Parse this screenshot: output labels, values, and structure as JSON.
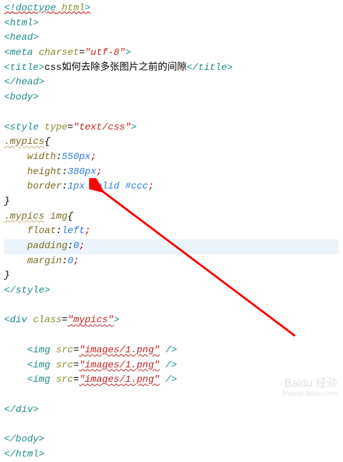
{
  "lines": {
    "l1_a": "<!",
    "l1_b": "doctype",
    "l1_c": " html",
    "l1_d": ">",
    "l2": "<html>",
    "l3": "<head>",
    "l4_a": "<meta ",
    "l4_attr": "charset",
    "l4_eq": "=",
    "l4_val": "\"utf-8\"",
    "l4_end": ">",
    "l5_a": "<title>",
    "l5_txt": "css如何去除多张图片之前的间隙",
    "l5_b": "</title>",
    "l6": "</head>",
    "l7": "<body>",
    "l9_a": "<style ",
    "l9_attr": "type",
    "l9_eq": "=",
    "l9_val": "\"text/css\"",
    "l9_end": ">",
    "l10_sel": ".mypics",
    "l10_brace": "{",
    "l11_prop": "width",
    "l11_val": "550px",
    "l12_prop": "height",
    "l12_val": "380px",
    "l13_prop": "border",
    "l13_val": "1px solid #ccc",
    "l14_brace": "}",
    "l15_sel1": ".mypics",
    "l15_sel2": " img",
    "l15_brace": "{",
    "l16_prop": "float",
    "l16_val": "left",
    "l17_prop": "padding",
    "l17_val": "0",
    "l18_prop": "margin",
    "l18_val": "0",
    "l19_brace": "}",
    "l20": "</style>",
    "l22_a": "<div ",
    "l22_attr": "class",
    "l22_eq": "=",
    "l22_val": "\"mypics\"",
    "l22_end": ">",
    "l24_a": "<img ",
    "l24_attr": "src",
    "l24_eq": "=",
    "l24_val": "\"images/1.png\"",
    "l24_end": " />",
    "l27": "</div>",
    "l29": "</body>",
    "l30": "</html>"
  },
  "watermark": {
    "main": "Baidu 经验",
    "sub": "jingyan.baidu.com"
  }
}
